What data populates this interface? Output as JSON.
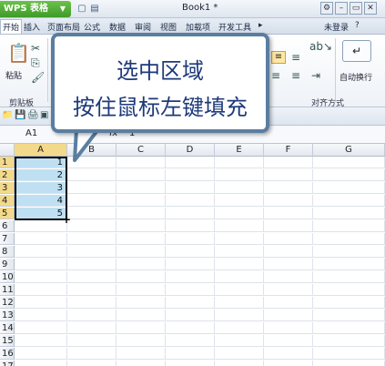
{
  "app": {
    "menu_button": "WPS 表格",
    "doc_title": "Book1 *"
  },
  "tabs": [
    "开始",
    "插入",
    "页面布局",
    "公式",
    "数据",
    "审阅",
    "视图",
    "加载项",
    "开发工具"
  ],
  "login": "未登录",
  "ribbon": {
    "paste_label": "粘贴",
    "clipboard_group": "剪贴板",
    "align_group": "对齐方式",
    "wrap_label": "自动换行"
  },
  "formula_bar": {
    "name_box": "A1",
    "fx": "fx",
    "value": "1"
  },
  "columns": [
    "A",
    "B",
    "C",
    "D",
    "E",
    "F",
    "G"
  ],
  "rows": [
    "1",
    "2",
    "3",
    "4",
    "5",
    "6",
    "7",
    "8",
    "9",
    "10",
    "11",
    "12",
    "13",
    "14",
    "15",
    "16",
    "17"
  ],
  "cells": {
    "A1": "1",
    "A2": "2",
    "A3": "3",
    "A4": "4",
    "A5": "5"
  },
  "callout": {
    "line1": "选中区域",
    "line2": "按住鼠标左键填充"
  },
  "colors": {
    "selection": "#bfe0f2",
    "header_highlight": "#f3d98b",
    "callout_text": "#1e3a7a",
    "wps_green": "#4ba832"
  }
}
